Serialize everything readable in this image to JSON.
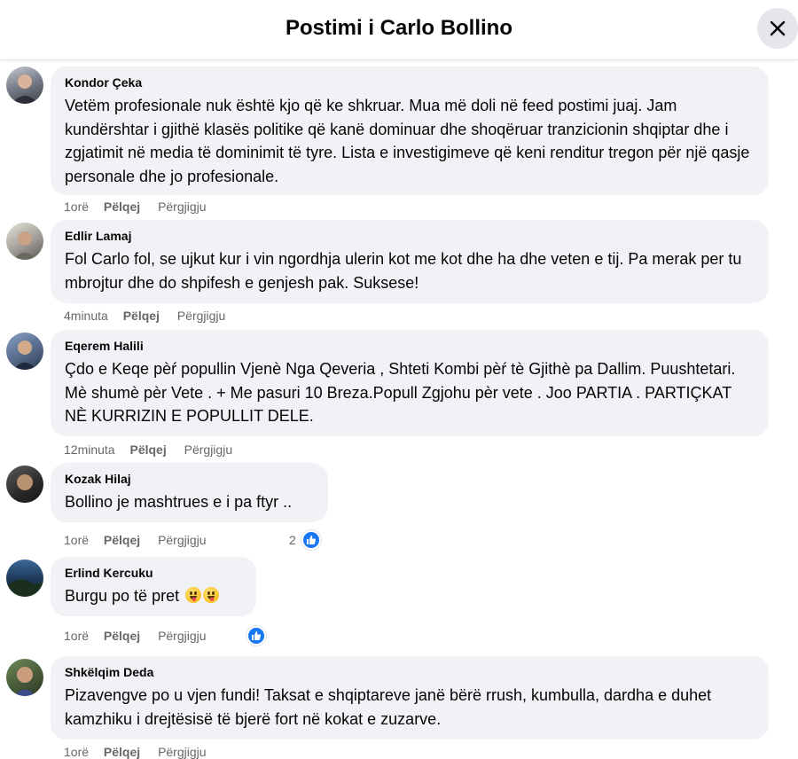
{
  "header": {
    "title": "Postimi i Carlo Bollino",
    "close_icon": "close-icon"
  },
  "colors": {
    "bubble": "#f0f2f5",
    "meta": "#65676b",
    "like_blue": "#1877f2"
  },
  "comments": [
    {
      "author": "Kondor Çeka",
      "text": "Vetëm profesionale nuk është kjo që ke shkruar. Mua më doli në feed postimi juaj. Jam kundërshtar i gjithë klasës politike që kanë dominuar dhe shoqëruar tranzicionin shqiptar dhe i zgjatimit në media të dominimit të tyre. Lista e investigimeve që keni renditur tregon për një qasje personale dhe jo profesionale.",
      "time": "1orë",
      "like": "Pëlqej",
      "reply": "Përgjigju"
    },
    {
      "author": "Edlir Lamaj",
      "text": "Fol Carlo fol, se ujkut kur i vin ngordhja ulerin kot me kot dhe ha dhe veten e tij. Pa merak per tu mbrojtur dhe do shpifesh e genjesh pak. Suksese!",
      "time": "4minuta",
      "like": "Pëlqej",
      "reply": "Përgjigju"
    },
    {
      "author": "Eqerem Halili",
      "text": "Çdo e Keqe pèŕ popullin Vjenè Nga Qeveria , Shteti Kombi pèŕ tè Gjithè pa Dallim. Puushtetari. Mè shumè pèr Vete . + Me pasuri 10 Breza.Popull Zgjohu pèr vete . Joo PARTIA . PARTIÇKAT NÈ KURRIZIN E POPULLIT DELE.",
      "time": "12minuta",
      "like": "Pëlqej",
      "reply": "Përgjigju"
    },
    {
      "author": "Kozak Hilaj",
      "text": "Bollino je mashtrues e i pa ftyr ..",
      "time": "1orë",
      "like": "Pëlqej",
      "reply": "Përgjigju",
      "reaction_count": "2"
    },
    {
      "author": "Erlind Kercuku",
      "text": "Burgu po të pret",
      "time": "1orë",
      "like": "Pëlqej",
      "reply": "Përgjigju",
      "emoji": "tongue-face-emoji"
    },
    {
      "author": "Shkëlqim Deda",
      "text": "Pizavengve po u vjen fundi! Taksat e shqiptareve janë bërë rrush, kumbulla, dardha e duhet kamzhiku i drejtësisë të bjerë fort në kokat e zuzarve.",
      "time": "1orë",
      "like": "Pëlqej",
      "reply": "Përgjigju"
    }
  ]
}
